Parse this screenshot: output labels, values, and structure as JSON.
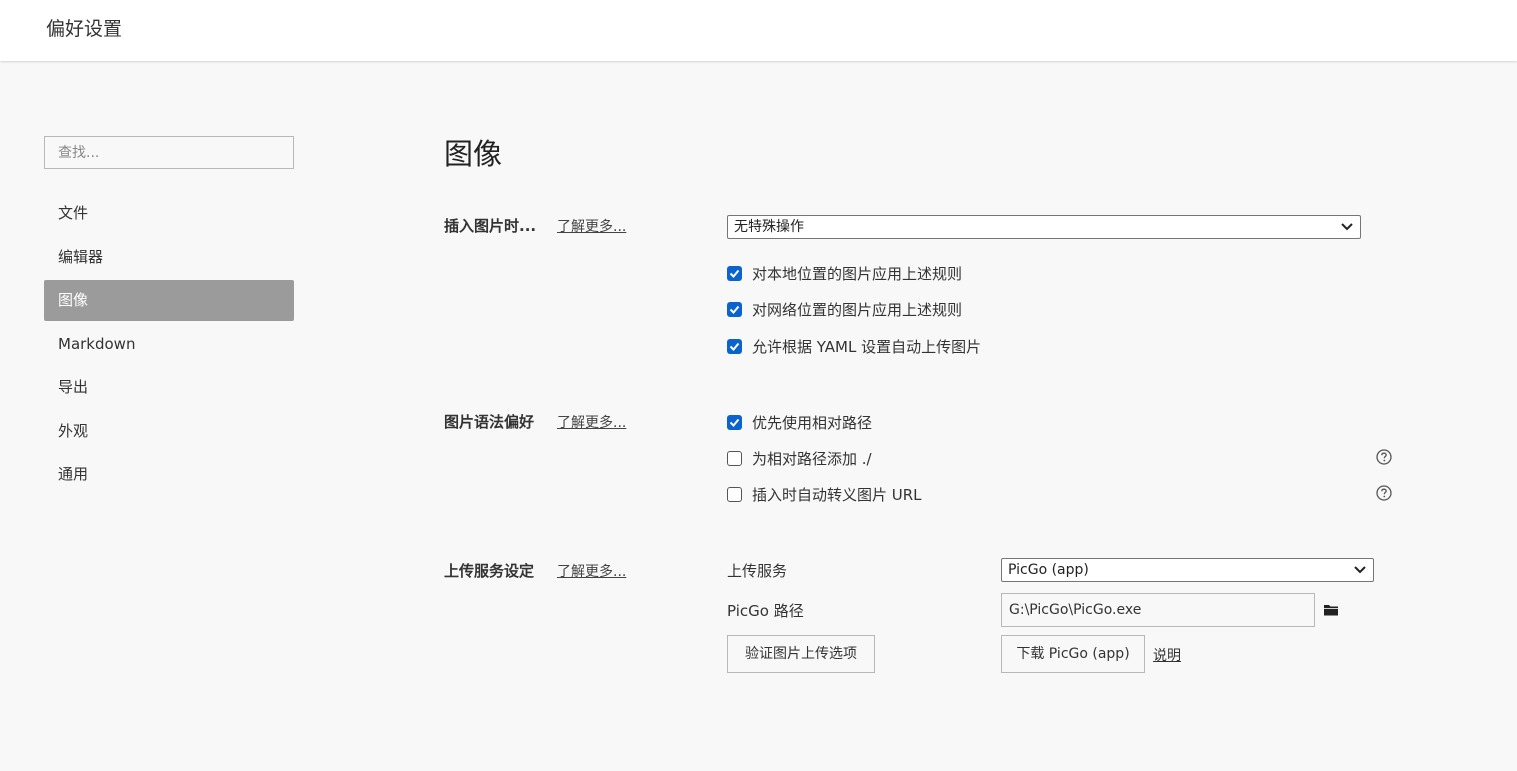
{
  "window": {
    "title": "偏好设置"
  },
  "sidebar": {
    "search_placeholder": "查找...",
    "items": [
      {
        "label": "文件",
        "active": false
      },
      {
        "label": "编辑器",
        "active": false
      },
      {
        "label": "图像",
        "active": true
      },
      {
        "label": "Markdown",
        "active": false
      },
      {
        "label": "导出",
        "active": false
      },
      {
        "label": "外观",
        "active": false
      },
      {
        "label": "通用",
        "active": false
      }
    ]
  },
  "main": {
    "title": "图像",
    "insert_section": {
      "label": "插入图片时...",
      "learn_more": "了解更多...",
      "action_select": "无特殊操作",
      "options": [
        {
          "label": "对本地位置的图片应用上述规则",
          "checked": true
        },
        {
          "label": "对网络位置的图片应用上述规则",
          "checked": true
        },
        {
          "label": "允许根据 YAML 设置自动上传图片",
          "checked": true
        }
      ]
    },
    "syntax_section": {
      "label": "图片语法偏好",
      "learn_more": "了解更多...",
      "options": [
        {
          "label": "优先使用相对路径",
          "checked": true,
          "help": false
        },
        {
          "label": "为相对路径添加 ./",
          "checked": false,
          "help": true
        },
        {
          "label": "插入时自动转义图片 URL",
          "checked": false,
          "help": true
        }
      ]
    },
    "upload_section": {
      "label": "上传服务设定",
      "learn_more": "了解更多...",
      "service_label": "上传服务",
      "service_value": "PicGo (app)",
      "path_label": "PicGo 路径",
      "path_value": "G:\\PicGo\\PicGo.exe",
      "verify_button": "验证图片上传选项",
      "download_button": "下载 PicGo (app)",
      "explain_link": "说明"
    }
  },
  "colors": {
    "accent": "#0b63ce",
    "active_nav": "#9b9b9b",
    "background": "#f8f8f8"
  },
  "icons": {
    "help": "question-circle-icon",
    "folder": "folder-icon",
    "dropdown": "chevron-down-icon"
  }
}
